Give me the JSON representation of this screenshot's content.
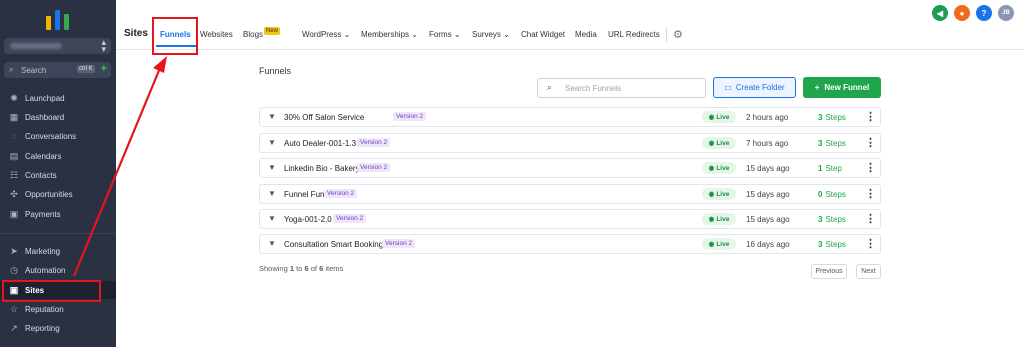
{
  "sidebar": {
    "logo_colors": [
      "#f4b400",
      "#1a73e8",
      "#34a853"
    ],
    "search": {
      "placeholder": "Search",
      "shortcut": "ctrl K"
    },
    "items": [
      {
        "label": "Launchpad",
        "icon": "launchpad-icon"
      },
      {
        "label": "Dashboard",
        "icon": "dashboard-icon"
      },
      {
        "label": "Conversations",
        "icon": "chat-icon"
      },
      {
        "label": "Calendars",
        "icon": "calendar-icon"
      },
      {
        "label": "Contacts",
        "icon": "contacts-icon"
      },
      {
        "label": "Opportunities",
        "icon": "opportunities-icon"
      },
      {
        "label": "Payments",
        "icon": "payments-icon"
      },
      {
        "label": "Marketing",
        "icon": "send-icon"
      },
      {
        "label": "Automation",
        "icon": "automation-icon"
      },
      {
        "label": "Sites",
        "icon": "sites-icon",
        "active": true
      },
      {
        "label": "Reputation",
        "icon": "star-icon"
      },
      {
        "label": "Reporting",
        "icon": "chart-icon"
      }
    ]
  },
  "topnav": {
    "section_title": "Sites",
    "tabs": [
      "Funnels",
      "Websites",
      "Blogs",
      "WordPress",
      "Memberships",
      "Forms",
      "Surveys",
      "Chat Widget",
      "Media",
      "URL Redirects"
    ],
    "active_tab": "Funnels",
    "new_badge": "New",
    "avatar_initials": "JB",
    "help_label": "?"
  },
  "main": {
    "heading": "Funnels",
    "search_placeholder": "Search Funnels",
    "create_folder_label": "Create Folder",
    "new_funnel_label": "New Funnel",
    "live_label": "Live",
    "rows": [
      {
        "name": "30% Off Salon Service",
        "version": "Version 2",
        "updated": "2 hours ago",
        "steps_count": "3",
        "steps_label": "Steps"
      },
      {
        "name": "Auto Dealer-001-1.3",
        "version": "Version 2",
        "updated": "7 hours ago",
        "steps_count": "3",
        "steps_label": "Steps"
      },
      {
        "name": "Linkedin Bio - Bakery",
        "version": "Version 2",
        "updated": "15 days ago",
        "steps_count": "1",
        "steps_label": "Step"
      },
      {
        "name": "Funnel Fun",
        "version": "Version 2",
        "updated": "15 days ago",
        "steps_count": "0",
        "steps_label": "Steps"
      },
      {
        "name": "Yoga-001-2.0",
        "version": "Version 2",
        "updated": "15 days ago",
        "steps_count": "3",
        "steps_label": "Steps"
      },
      {
        "name": "Consultation Smart Booking",
        "version": "Version 2",
        "updated": "16 days ago",
        "steps_count": "3",
        "steps_label": "Steps"
      }
    ],
    "pagination": {
      "showing_prefix": "Showing",
      "from": "1",
      "to_word": "to",
      "to": "6",
      "of_word": "of",
      "total": "6",
      "suffix": "items",
      "previous_label": "Previous",
      "next_label": "Next"
    }
  },
  "colors": {
    "accent": "#1a73e8",
    "primary_green": "#1fa54b",
    "sidebar_bg": "#2a3142",
    "annotation_red": "#e5161b"
  }
}
